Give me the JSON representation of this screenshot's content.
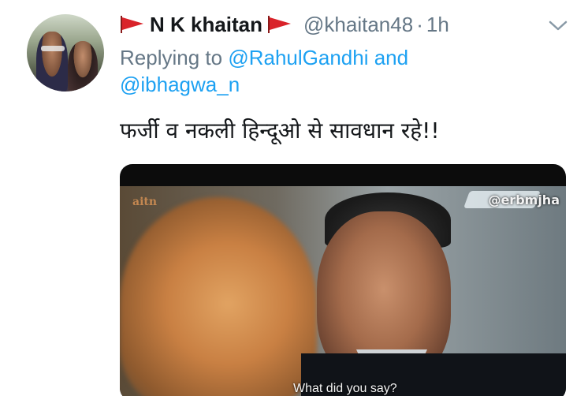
{
  "author": {
    "name": "N K khaitan",
    "handle": "@khaitan48",
    "separator": "·",
    "time": "1h",
    "flag_color": "#d9232a"
  },
  "reply": {
    "prefix": "Replying to",
    "mention1": "@RahulGandhi",
    "and": "and",
    "mention2": "@ibhagwa_n"
  },
  "tweet": {
    "text": "फर्जी व नकली हिन्दूओ से सावधान रहे!!"
  },
  "media": {
    "channel_logo": "aitn",
    "watermark": "@erbmjha",
    "subtitle": "What did you say?"
  },
  "icons": {
    "menu": "chevron-down-icon",
    "flag": "flag-icon"
  },
  "colors": {
    "link": "#1da1f2",
    "secondary_text": "#657786",
    "primary_text": "#14171a"
  }
}
